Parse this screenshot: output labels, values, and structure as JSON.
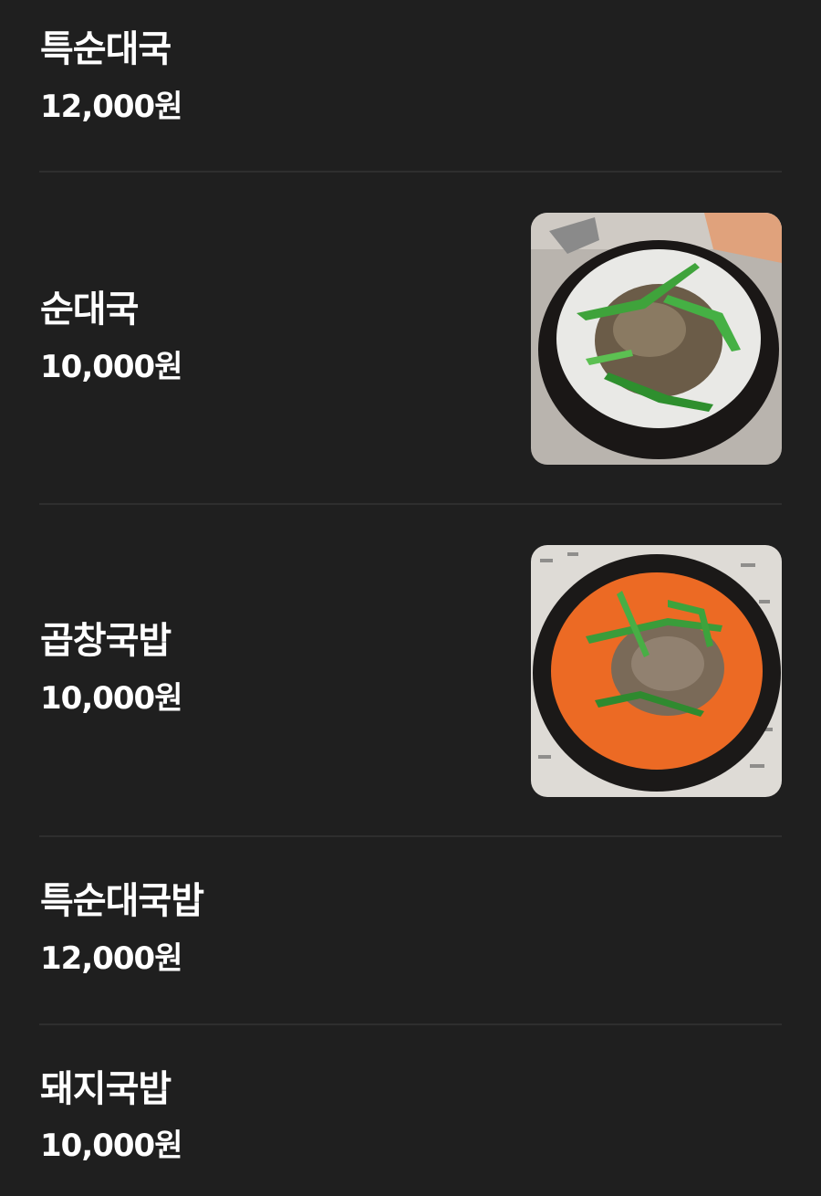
{
  "menu": {
    "items": [
      {
        "name": "특순대국",
        "price": "12,000원",
        "photo": null
      },
      {
        "name": "순대국",
        "price": "10,000원",
        "photo": "sundae-soup-photo"
      },
      {
        "name": "곱창국밥",
        "price": "10,000원",
        "photo": "gopchang-soup-photo"
      },
      {
        "name": "특순대국밥",
        "price": "12,000원",
        "photo": null
      },
      {
        "name": "돼지국밥",
        "price": "10,000원",
        "photo": null
      }
    ]
  },
  "colors": {
    "background": "#1f1f1f",
    "divider": "#2e2e2e",
    "text": "#ffffff"
  }
}
